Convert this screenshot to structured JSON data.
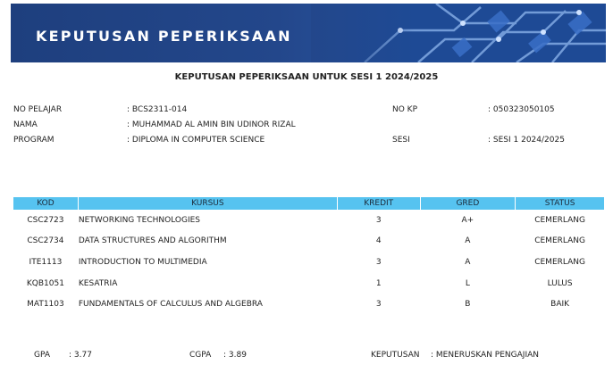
{
  "banner": {
    "title": "KEPUTUSAN PEPERIKSAAN"
  },
  "heading": "KEPUTUSAN PEPERIKSAAN UNTUK SESI 1 2024/2025",
  "student": {
    "no_pelajar_label": "NO PELAJAR",
    "no_pelajar_value": ": BCS2311-014",
    "nama_label": "NAMA",
    "nama_value": ": MUHAMMAD AL AMIN BIN UDINOR RIZAL",
    "program_label": "PROGRAM",
    "program_value": ": DIPLOMA IN COMPUTER SCIENCE",
    "no_kp_label": "NO KP",
    "no_kp_value": ": 050323050105",
    "sesi_label": "SESI",
    "sesi_value": ": SESI 1 2024/2025"
  },
  "table": {
    "headers": [
      "KOD",
      "KURSUS",
      "KREDIT",
      "GRED",
      "STATUS"
    ],
    "rows": [
      [
        "CSC2723",
        "NETWORKING TECHNOLOGIES",
        "3",
        "A+",
        "CEMERLANG"
      ],
      [
        "CSC2734",
        "DATA STRUCTURES AND ALGORITHM",
        "4",
        "A",
        "CEMERLANG"
      ],
      [
        "ITE1113",
        "INTRODUCTION TO MULTIMEDIA",
        "3",
        "A",
        "CEMERLANG"
      ],
      [
        "KQB1051",
        "KESATRIA",
        "1",
        "L",
        "LULUS"
      ],
      [
        "MAT1103",
        "FUNDAMENTALS OF CALCULUS AND ALGEBRA",
        "3",
        "B",
        "BAIK"
      ]
    ]
  },
  "summary": {
    "gpa_label": "GPA",
    "gpa_value": ": 3.77",
    "cgpa_label": "CGPA",
    "cgpa_value": ": 3.89",
    "keputusan_label": "KEPUTUSAN",
    "keputusan_value": ": MENERUSKAN PENGAJIAN"
  },
  "colors": {
    "banner": "#23478b",
    "table_header": "#56c3f0"
  }
}
